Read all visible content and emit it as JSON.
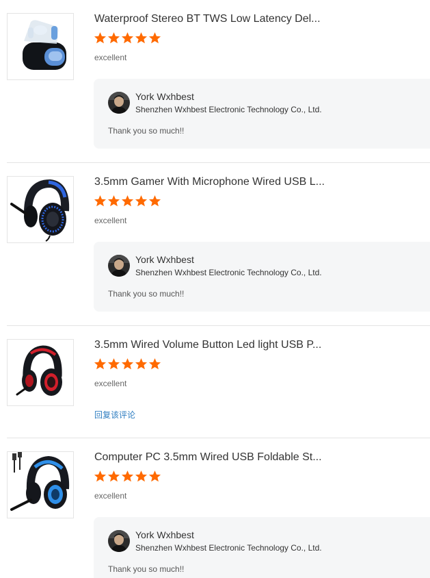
{
  "colors": {
    "star": "#ff6a00",
    "link": "#2f7ec1",
    "reply_bg": "#f5f6f7"
  },
  "reviews": [
    {
      "product_title": "Waterproof Stereo BT TWS Low Latency Del...",
      "product_icon": "earbuds-case-image",
      "star_count": 5,
      "rating_text": "excellent",
      "reply": {
        "seller_name": "York Wxhbest",
        "seller_company": "Shenzhen Wxhbest Electronic Technology Co., Ltd.",
        "text": "Thank you so much!!"
      }
    },
    {
      "product_title": "3.5mm Gamer With Microphone Wired USB L...",
      "product_icon": "gaming-headset-blue-image",
      "star_count": 5,
      "rating_text": "excellent",
      "reply": {
        "seller_name": "York Wxhbest",
        "seller_company": "Shenzhen Wxhbest Electronic Technology Co., Ltd.",
        "text": "Thank you so much!!"
      }
    },
    {
      "product_title": "3.5mm Wired Volume Button Led light USB P...",
      "product_icon": "gaming-headset-red-image",
      "star_count": 5,
      "rating_text": "excellent",
      "reply_link": "回复该评论"
    },
    {
      "product_title": "Computer PC 3.5mm Wired USB Foldable St...",
      "product_icon": "gaming-headset-blue-led-image",
      "star_count": 5,
      "rating_text": "excellent",
      "reply": {
        "seller_name": "York Wxhbest",
        "seller_company": "Shenzhen Wxhbest Electronic Technology Co., Ltd.",
        "text": "Thank you so much!!"
      }
    }
  ]
}
